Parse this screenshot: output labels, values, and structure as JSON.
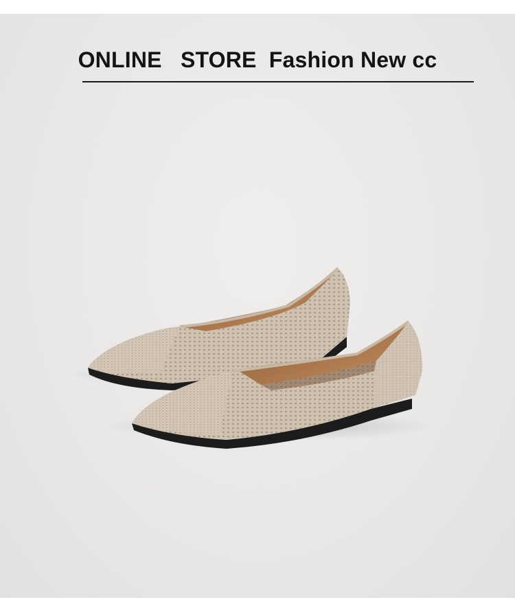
{
  "banner": {
    "title": "ONLINE   STORE  Fashion New cc"
  },
  "colors": {
    "background": "#e9e8e6",
    "knit": "#cdbfae",
    "lining": "#b27a4d",
    "sole": "#1c1c1c",
    "text": "#141414"
  },
  "product": {
    "image_icon": "knit-pointed-flats-pair"
  }
}
